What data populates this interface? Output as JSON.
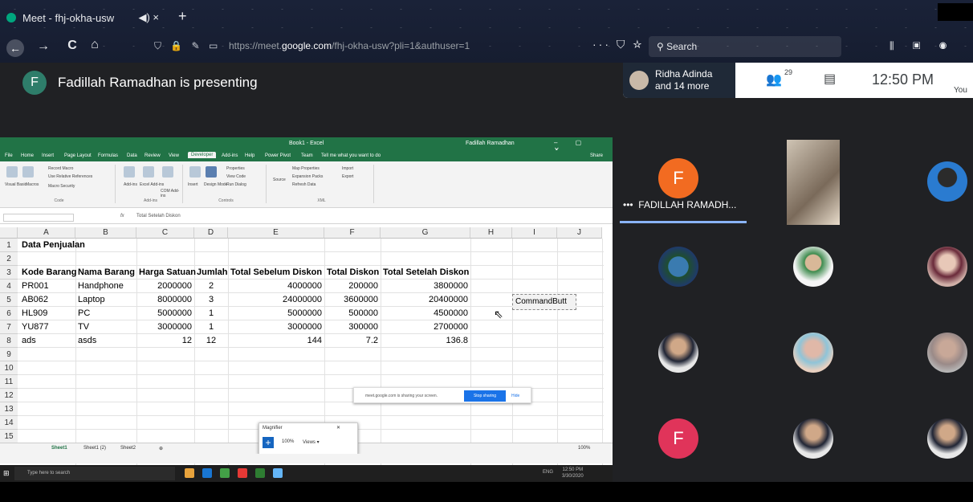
{
  "browser": {
    "tab_title": "Meet - fhj-okha-usw",
    "tab_audio_close": "◀) ×",
    "new_tab": "+",
    "nav_icons": [
      "←",
      "→",
      "C",
      "⌂"
    ],
    "url_domain_prefix": "https://meet.",
    "url_domain": "google.com",
    "url_path": "/fhj-okha-usw?pli=1&authuser=1",
    "url_more": "··· ⛉ ☆",
    "search_placeholder": "Search"
  },
  "meet": {
    "presenter_initial": "F",
    "presenting_text": "Fadillah Ramadhan is presenting",
    "participants_chip": [
      "Ridha Adinda",
      "and 14 more"
    ],
    "people_count": "29",
    "time": "12:50 PM",
    "you_label": "You",
    "active_speaker": "FADILLAH RAMADH...",
    "tile_initials": [
      "F",
      "F"
    ]
  },
  "excel": {
    "title": "Book1 - Excel",
    "user": "Fadillah Ramadhan",
    "ribbon_tabs": [
      "File",
      "Home",
      "Insert",
      "Page Layout",
      "Formulas",
      "Data",
      "Review",
      "View",
      "Developer",
      "Add-ins",
      "Help",
      "Power Pivot",
      "Team",
      "Tell me what you want to do",
      "Share"
    ],
    "active_tab": "Developer",
    "ribbon_groups": [
      "Code",
      "Add-ins",
      "Controls",
      "XML"
    ],
    "ribbon_buttons": [
      "Visual Basic",
      "Macros",
      "Record Macro",
      "Use Relative References",
      "Macro Security",
      "Add-ins",
      "Excel Add-ins",
      "COM Add-ins",
      "Insert",
      "Design Mode",
      "Properties",
      "View Code",
      "Run Dialog",
      "Source",
      "Map Properties",
      "Expansion Packs",
      "Refresh Data",
      "Import",
      "Export"
    ],
    "formula_value": "Total Setelah Diskon",
    "fx": "fx",
    "col_headers": [
      "A",
      "B",
      "C",
      "D",
      "E",
      "F",
      "G",
      "H",
      "I",
      "J"
    ],
    "row_headers": [
      "1",
      "2",
      "3",
      "4",
      "5",
      "6",
      "7",
      "8",
      "9",
      "10",
      "11",
      "12",
      "13",
      "14",
      "15"
    ],
    "title_cell": "Data Penjualan",
    "headers": [
      "Kode Barang",
      "Nama Barang",
      "Harga Satuan",
      "Jumlah",
      "Total Sebelum Diskon",
      "Total Diskon",
      "Total Setelah Diskon"
    ],
    "rows": [
      [
        "PR001",
        "Handphone",
        "2000000",
        "2",
        "4000000",
        "200000",
        "3800000"
      ],
      [
        "AB062",
        "Laptop",
        "8000000",
        "3",
        "24000000",
        "3600000",
        "20400000"
      ],
      [
        "HL909",
        "PC",
        "5000000",
        "1",
        "5000000",
        "500000",
        "4500000"
      ],
      [
        "YU877",
        "TV",
        "3000000",
        "1",
        "3000000",
        "300000",
        "2700000"
      ],
      [
        "ads",
        "asds",
        "12",
        "12",
        "144",
        "7.2",
        "136.8"
      ]
    ],
    "command_button": "CommandButt",
    "sheet_tabs": [
      "Sheet1",
      "Sheet1 (2)",
      "Sheet2",
      "⊕"
    ],
    "share_text": "meet.google.com is sharing your screen.",
    "stop_sharing": "Stop sharing",
    "hide": "Hide",
    "magnifier_title": "Magnifier",
    "magnifier_zoom": "100%",
    "magnifier_views": "Views ▾",
    "zoom_level": "100%"
  },
  "taskbar": {
    "search_placeholder": "Type here to search",
    "lang": "ENG",
    "clock_time": "12:50 PM",
    "clock_date": "3/30/2020",
    "app_colors": [
      "#e8a33c",
      "#1976d2",
      "#43a047",
      "#e53935",
      "#2e7d32",
      "#64b5f6"
    ]
  }
}
